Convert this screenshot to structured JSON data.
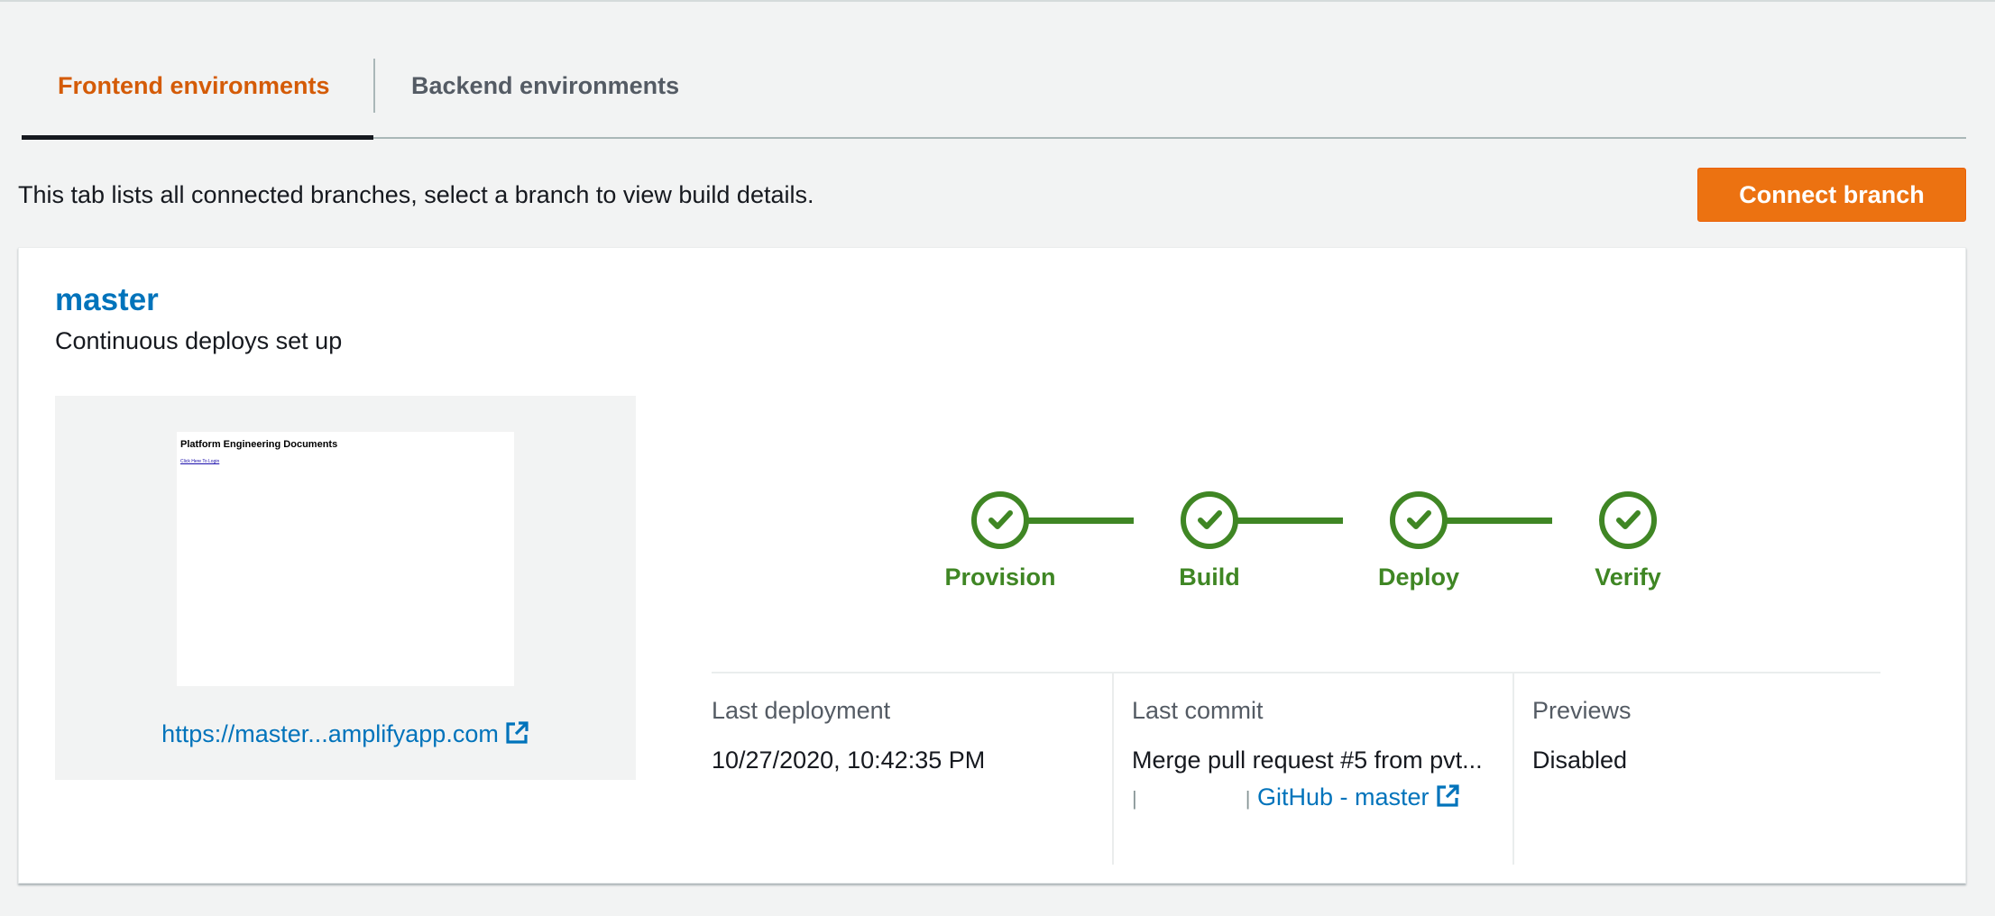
{
  "tabs": {
    "frontend": "Frontend environments",
    "backend": "Backend environments"
  },
  "description": "This tab lists all connected branches, select a branch to view build details.",
  "connect_button": "Connect branch",
  "branch": {
    "name": "master",
    "status": "Continuous deploys set up",
    "preview": {
      "page_title": "Platform Engineering Documents",
      "page_link": "Click Here To Login",
      "url": "https://master...amplifyapp.com"
    },
    "steps": [
      {
        "label": "Provision",
        "state": "complete"
      },
      {
        "label": "Build",
        "state": "complete"
      },
      {
        "label": "Deploy",
        "state": "complete"
      },
      {
        "label": "Verify",
        "state": "complete"
      }
    ],
    "last_deployment": {
      "label": "Last deployment",
      "value": "10/27/2020, 10:42:35 PM"
    },
    "last_commit": {
      "label": "Last commit",
      "message": "Merge pull request #5 from pvt...",
      "separator": "|",
      "repo_link": "GitHub - master"
    },
    "previews": {
      "label": "Previews",
      "value": "Disabled"
    }
  },
  "colors": {
    "accent": "#ec7211",
    "active_tab": "#d45b07",
    "link": "#0073bb",
    "success": "#3f8624"
  },
  "icons": [
    "external-link-icon",
    "checkmark-icon"
  ]
}
